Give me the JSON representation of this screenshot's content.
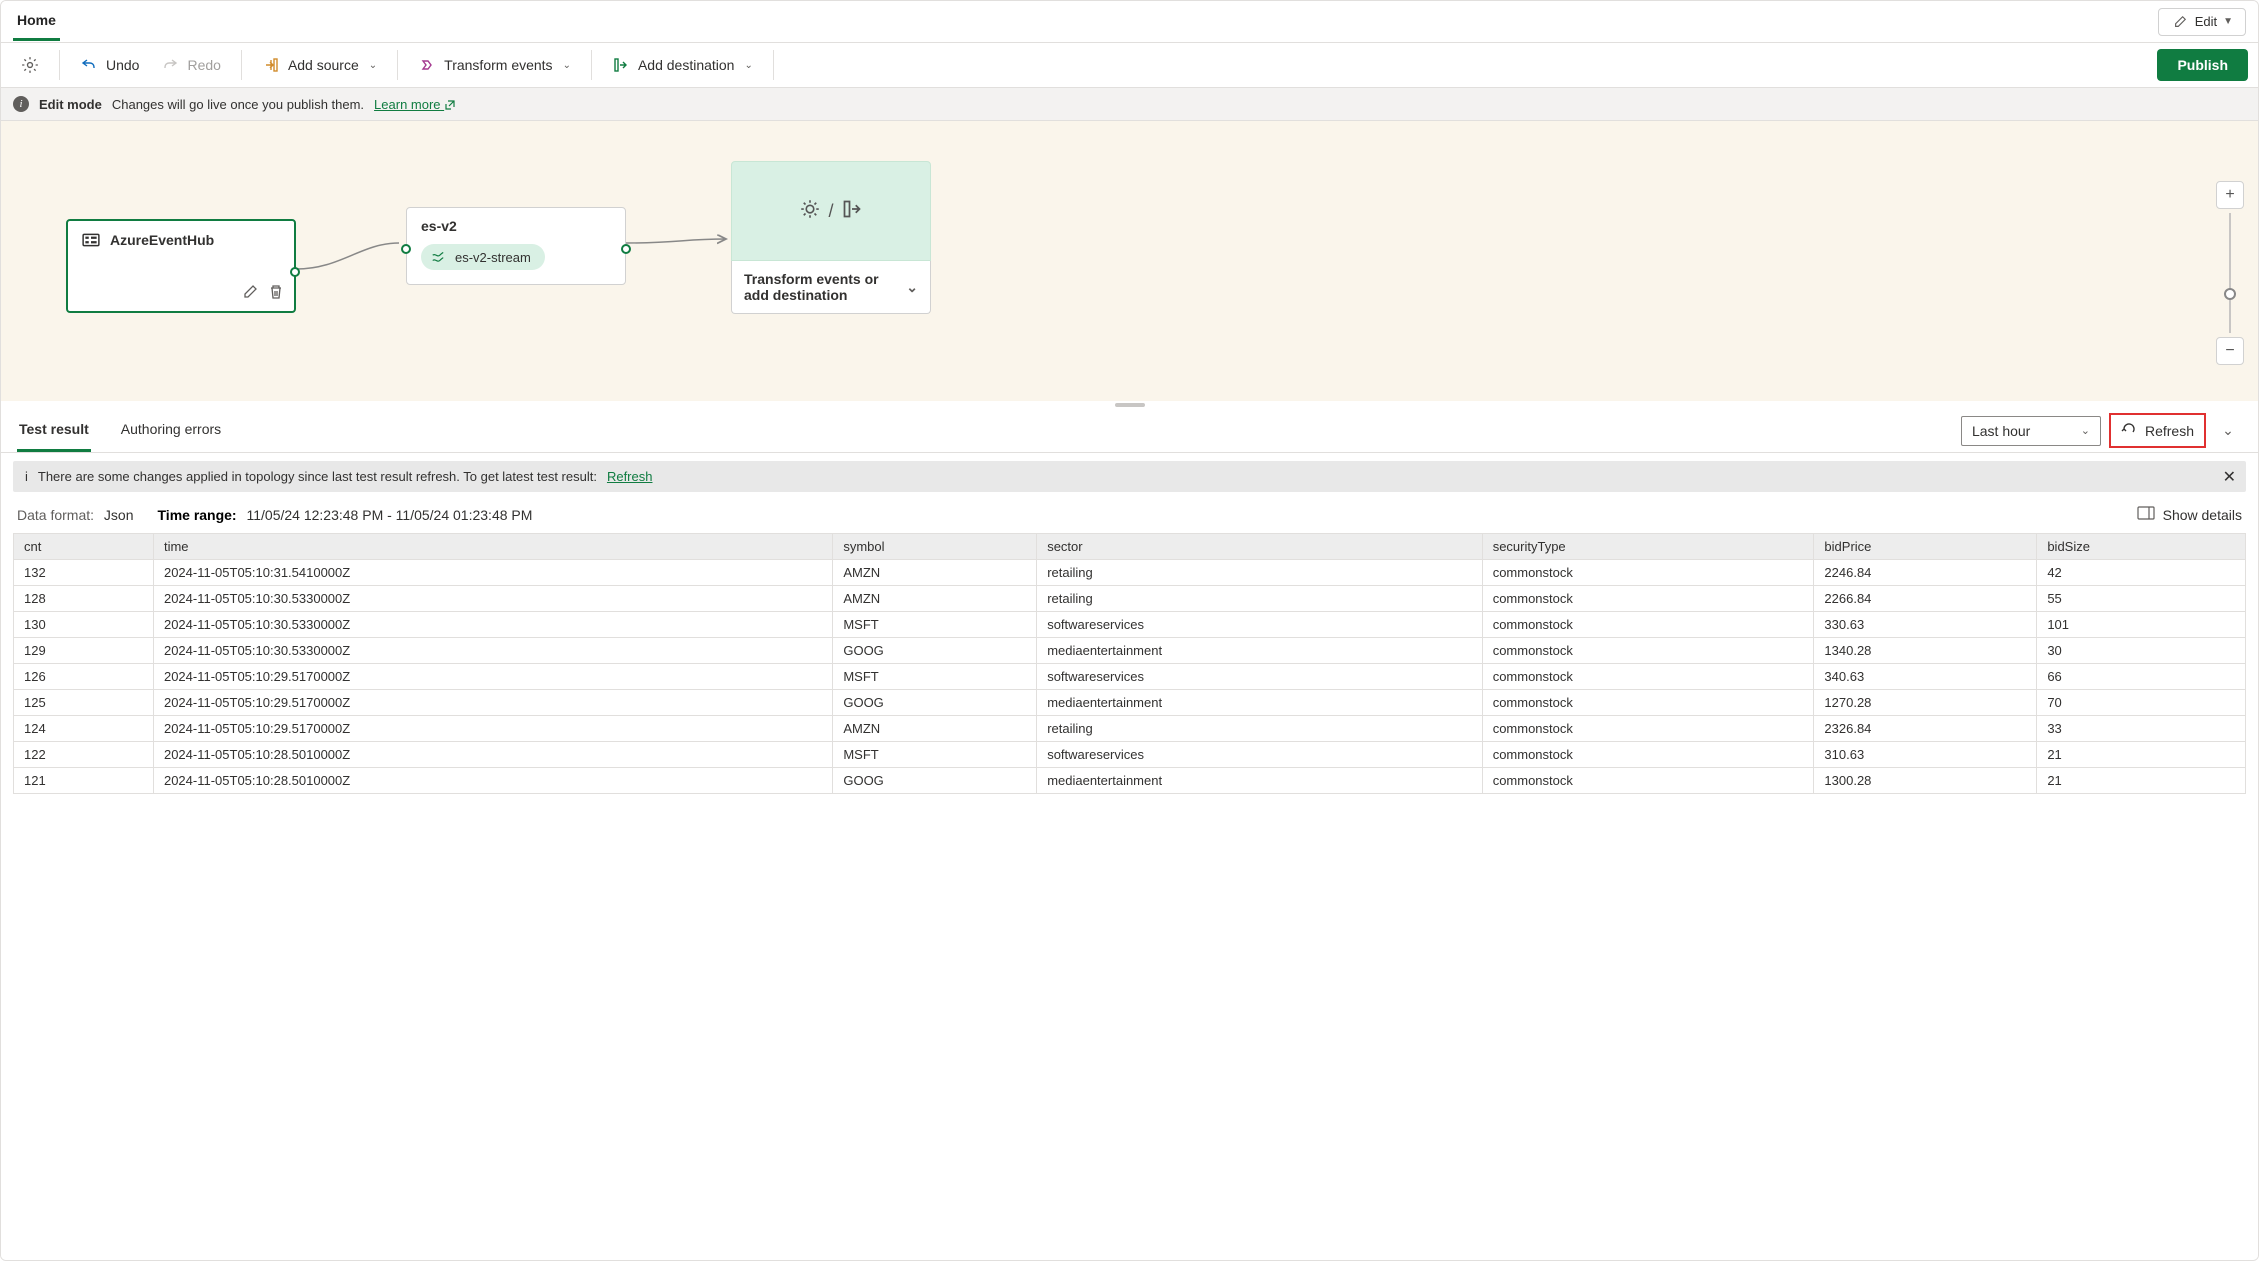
{
  "tabs": {
    "home": "Home"
  },
  "edit_menu": {
    "label": "Edit"
  },
  "toolbar": {
    "undo": "Undo",
    "redo": "Redo",
    "add_source": "Add source",
    "transform": "Transform events",
    "add_dest": "Add destination",
    "publish": "Publish"
  },
  "info": {
    "mode": "Edit mode",
    "msg": "Changes will go live once you publish them.",
    "learn_more": "Learn more"
  },
  "canvas": {
    "source": {
      "title": "AzureEventHub"
    },
    "middle": {
      "title": "es-v2",
      "stream": "es-v2-stream"
    },
    "dest": {
      "title": "Transform events or add destination",
      "sep": "/"
    }
  },
  "bottom": {
    "tabs": {
      "test": "Test result",
      "errors": "Authoring errors"
    },
    "time_select": "Last hour",
    "refresh": "Refresh",
    "alert": {
      "msg": "There are some changes applied in topology since last test result refresh. To get latest test result:",
      "link": "Refresh"
    },
    "meta": {
      "format_label": "Data format:",
      "format_value": "Json",
      "range_label": "Time range:",
      "range_value": "11/05/24 12:23:48 PM - 11/05/24 01:23:48 PM",
      "show_details": "Show details"
    },
    "columns": [
      "cnt",
      "time",
      "symbol",
      "sector",
      "securityType",
      "bidPrice",
      "bidSize"
    ],
    "rows": [
      [
        "132",
        "2024-11-05T05:10:31.5410000Z",
        "AMZN",
        "retailing",
        "commonstock",
        "2246.84",
        "42"
      ],
      [
        "128",
        "2024-11-05T05:10:30.5330000Z",
        "AMZN",
        "retailing",
        "commonstock",
        "2266.84",
        "55"
      ],
      [
        "130",
        "2024-11-05T05:10:30.5330000Z",
        "MSFT",
        "softwareservices",
        "commonstock",
        "330.63",
        "101"
      ],
      [
        "129",
        "2024-11-05T05:10:30.5330000Z",
        "GOOG",
        "mediaentertainment",
        "commonstock",
        "1340.28",
        "30"
      ],
      [
        "126",
        "2024-11-05T05:10:29.5170000Z",
        "MSFT",
        "softwareservices",
        "commonstock",
        "340.63",
        "66"
      ],
      [
        "125",
        "2024-11-05T05:10:29.5170000Z",
        "GOOG",
        "mediaentertainment",
        "commonstock",
        "1270.28",
        "70"
      ],
      [
        "124",
        "2024-11-05T05:10:29.5170000Z",
        "AMZN",
        "retailing",
        "commonstock",
        "2326.84",
        "33"
      ],
      [
        "122",
        "2024-11-05T05:10:28.5010000Z",
        "MSFT",
        "softwareservices",
        "commonstock",
        "310.63",
        "21"
      ],
      [
        "121",
        "2024-11-05T05:10:28.5010000Z",
        "GOOG",
        "mediaentertainment",
        "commonstock",
        "1300.28",
        "21"
      ]
    ]
  }
}
